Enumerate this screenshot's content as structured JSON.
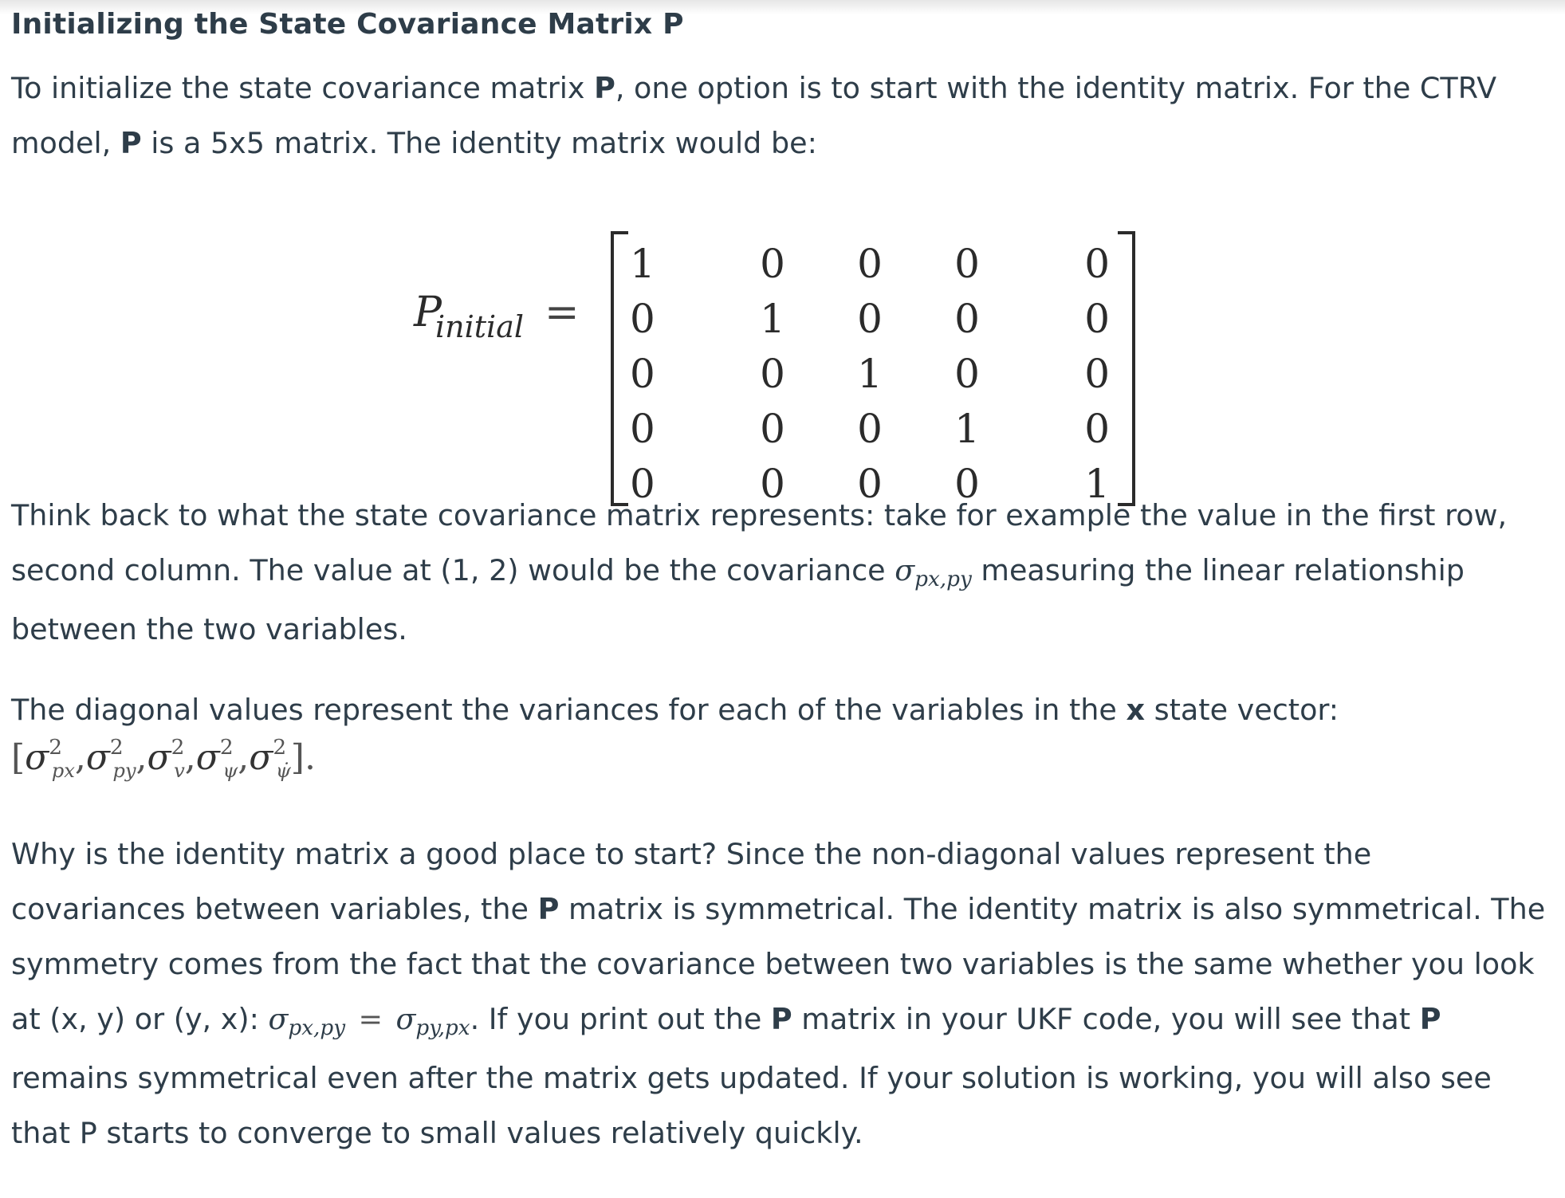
{
  "heading": "Initializing the State Covariance Matrix P",
  "para1": {
    "a": "To initialize the state covariance matrix ",
    "b": "P",
    "c": ", one option is to start with the identity matrix. For the CTRV model, ",
    "d": "P",
    "e": " is a 5x5 matrix. The identity matrix would be:"
  },
  "equation": {
    "lhs": "P",
    "lhs_sub": "initial",
    "equals": "=",
    "rows": [
      [
        "1",
        "0",
        "0",
        "0",
        "0"
      ],
      [
        "0",
        "1",
        "0",
        "0",
        "0"
      ],
      [
        "0",
        "0",
        "1",
        "0",
        "0"
      ],
      [
        "0",
        "0",
        "0",
        "1",
        "0"
      ],
      [
        "0",
        "0",
        "0",
        "0",
        "1"
      ]
    ]
  },
  "para2": {
    "a": "Think back to what the state covariance matrix represents: take for example the value in the first row, second column. The value at (1, 2) would be the covariance ",
    "sigma": "σ",
    "sigma_sub": "px,py",
    "b": " measuring the linear relationship between the two variables."
  },
  "para3": {
    "a": "The diagonal values represent the variances for each of the variables in the ",
    "b": "x",
    "c": " state vector:"
  },
  "variance_vector": {
    "open": "[",
    "sigma": "σ",
    "power": "2",
    "subs": [
      "px",
      "py",
      "v",
      "ψ",
      "ψ̇"
    ],
    "sep": ",",
    "close": "]."
  },
  "para4": {
    "a": "Why is the identity matrix a good place to start? Since the non-diagonal values represent the covariances between variables, the ",
    "b": "P",
    "c": " matrix is symmetrical. The identity matrix is also symmetrical. The symmetry comes from the fact that the covariance between two variables is the same whether you look at (x, y) or (y, x): ",
    "sigma1": "σ",
    "sigma1_sub": "px,py",
    "eq": "=",
    "sigma2": "σ",
    "sigma2_sub": "py,px",
    "dot": ".",
    "d": " If you print out the ",
    "e": "P",
    "f": " matrix in your UKF code, you will see that ",
    "g": "P",
    "h": " remains symmetrical even after the matrix gets updated. If your solution is working, you will also see that P starts to converge to small values relatively quickly."
  }
}
